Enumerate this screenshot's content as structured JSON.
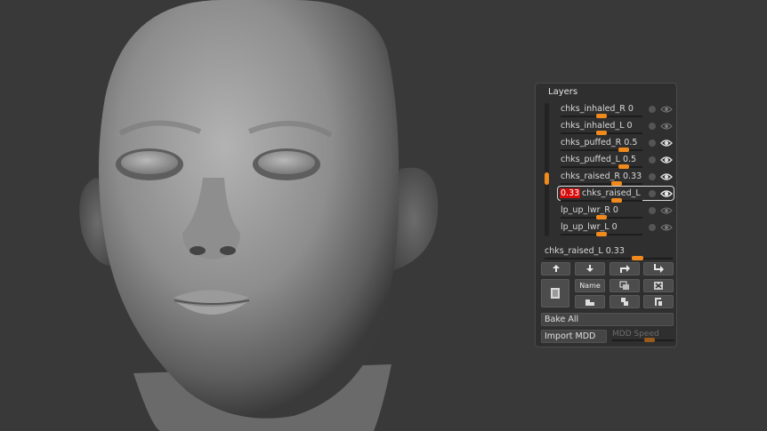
{
  "panel": {
    "title": "Layers",
    "layers": [
      {
        "name": "chks_inhaled_R",
        "value": "0",
        "level": 0,
        "visible": false
      },
      {
        "name": "chks_inhaled_L",
        "value": "0",
        "level": 0,
        "visible": false
      },
      {
        "name": "chks_puffed_R",
        "value": "0.5",
        "level": 0.5,
        "visible": true
      },
      {
        "name": "chks_puffed_L",
        "value": "0.5",
        "level": 0.5,
        "visible": true
      },
      {
        "name": "chks_raised_R",
        "value": "0.33",
        "level": 0.33,
        "visible": true
      },
      {
        "name": "chks_raised_L",
        "value": "0.33",
        "level": 0.33,
        "visible": true
      },
      {
        "name": "lp_up_lwr_R",
        "value": "0",
        "level": 0,
        "visible": false
      },
      {
        "name": "lp_up_lwr_L",
        "value": "0",
        "level": 0,
        "visible": false
      }
    ],
    "active_layer_label": "chks_raised_L",
    "active_layer_value": "0.33",
    "name_button": "Name",
    "bake_all": "Bake All",
    "import_mdd": "Import MDD",
    "mdd_speed": "MDD Speed"
  },
  "colors": {
    "accent": "#f08a1c",
    "selected_value_bg": "#d60d0d",
    "background": "#393939",
    "panel": "#2f2f2f"
  }
}
